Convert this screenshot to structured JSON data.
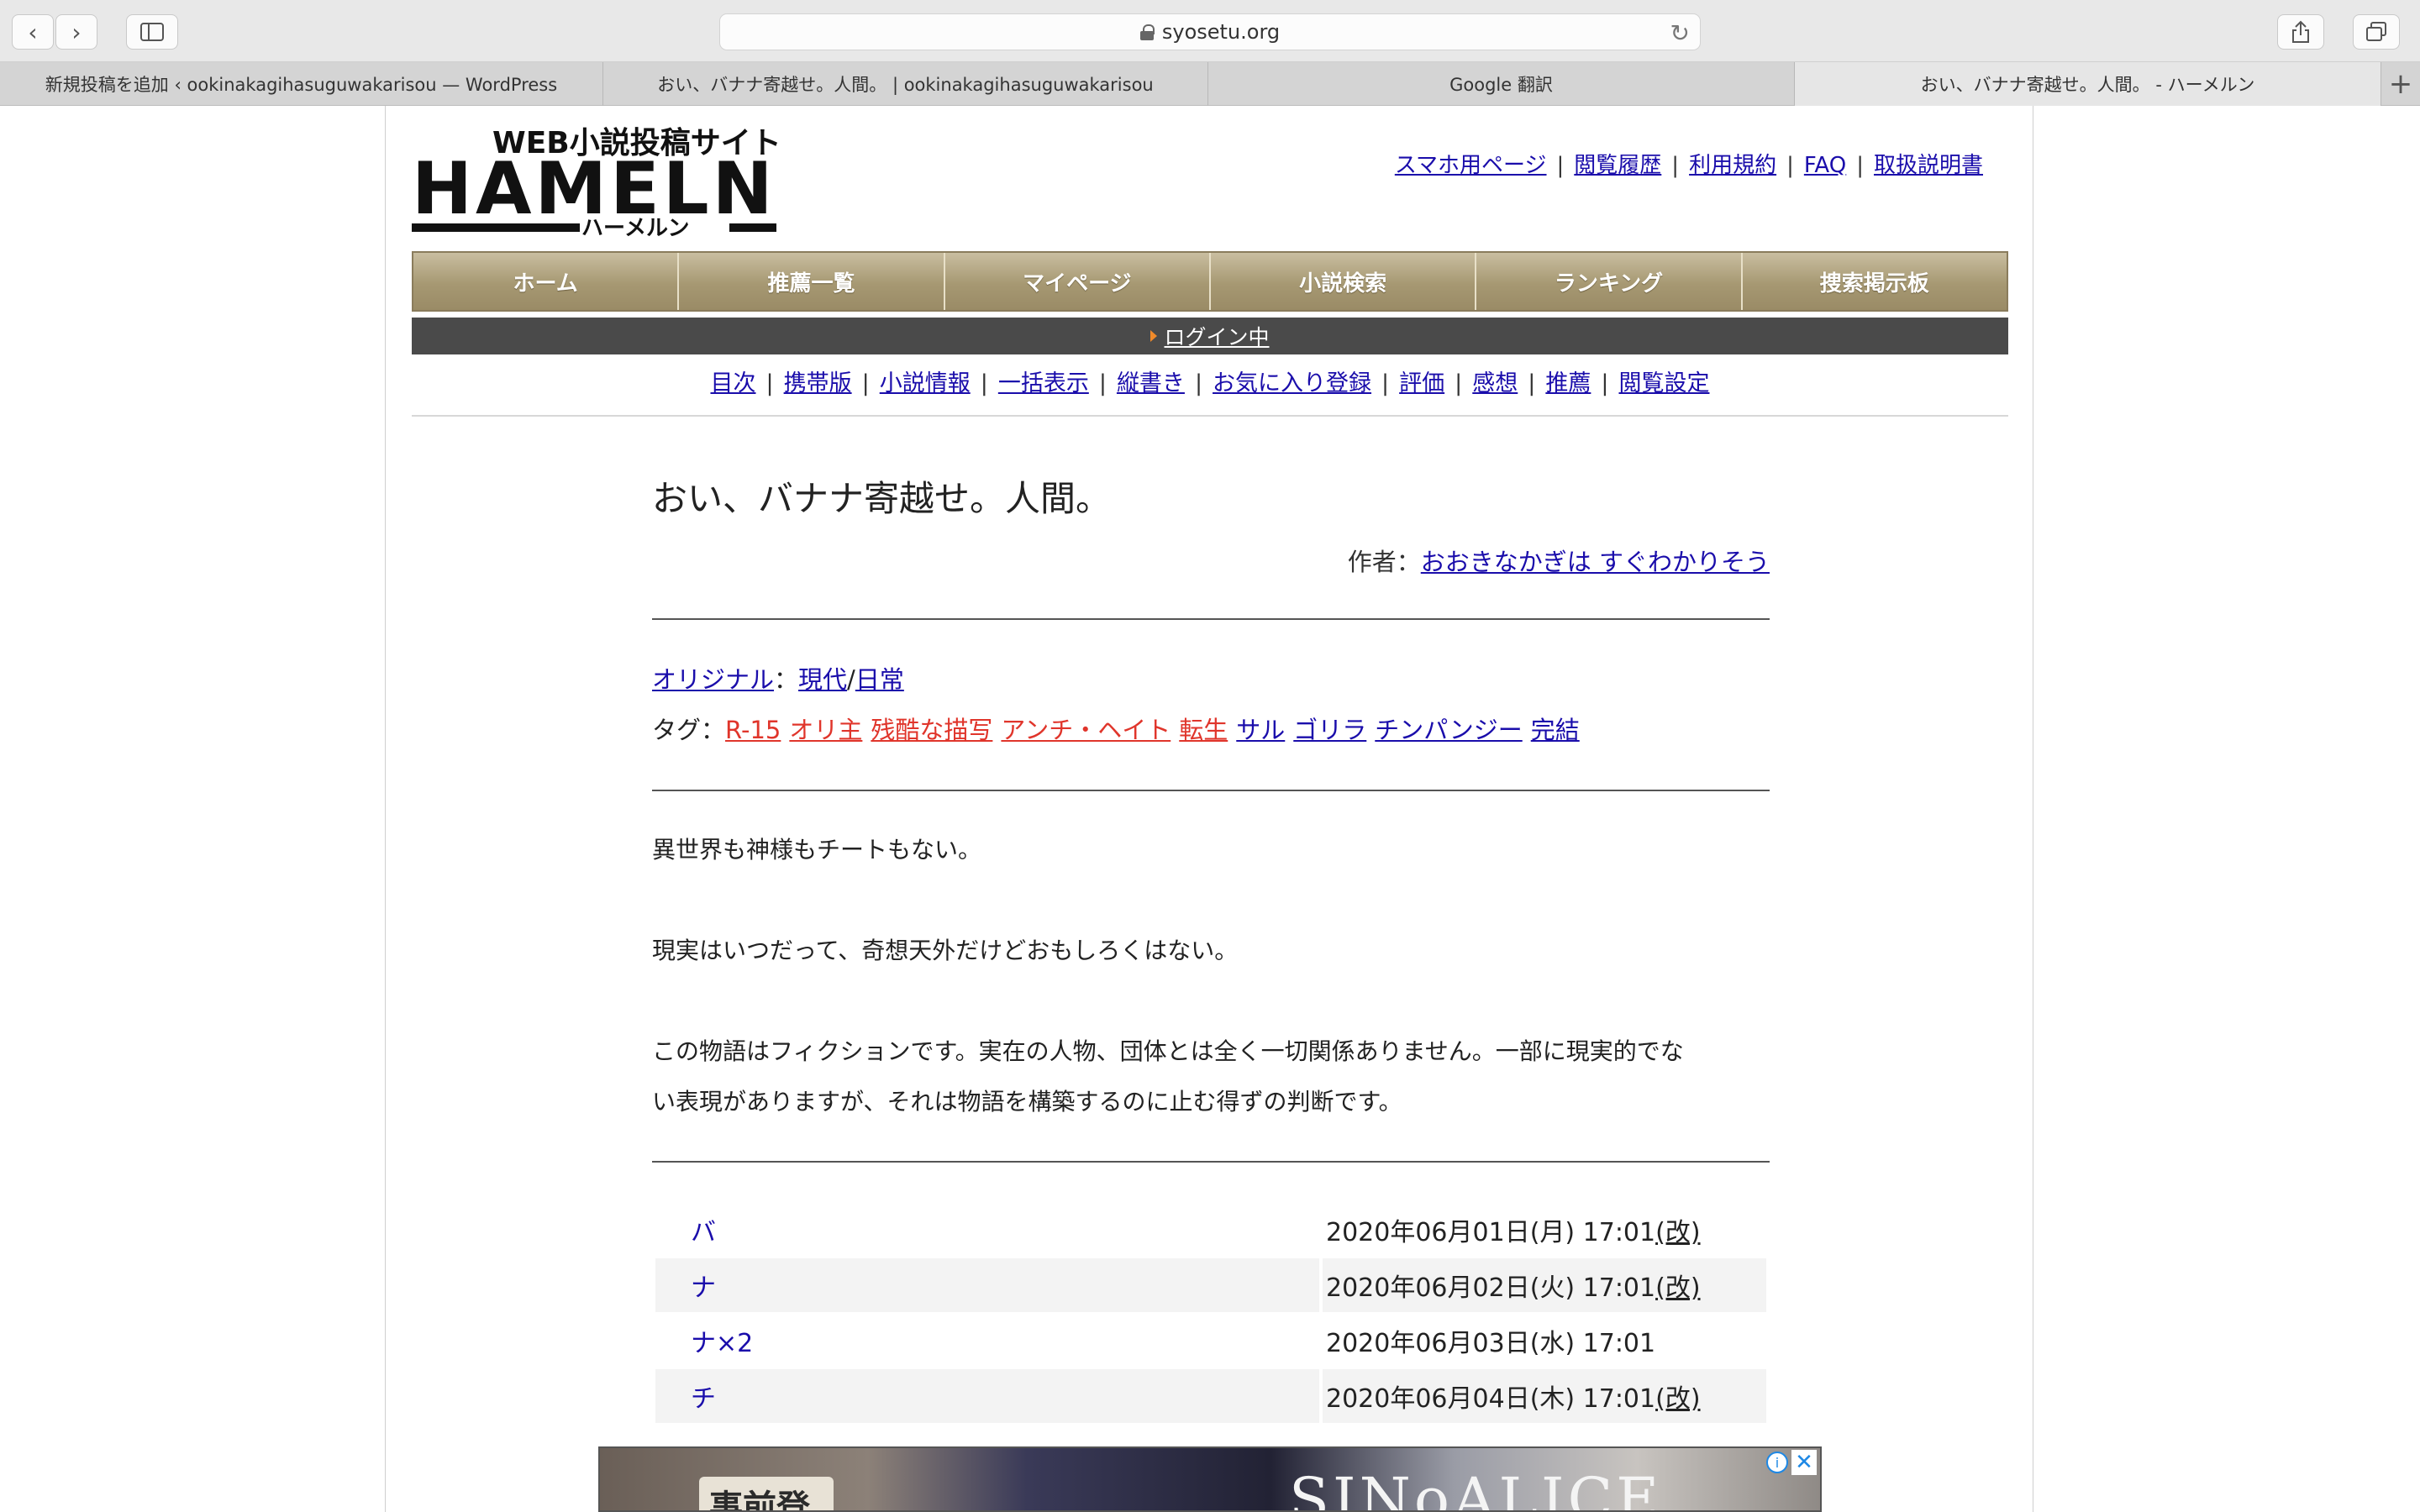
{
  "browser": {
    "url": "syosetu.org",
    "tabs": [
      {
        "title": "新規投稿を追加 ‹ ookinakagihasuguwakarisou — WordPress"
      },
      {
        "title": "おい、バナナ寄越せ。人間。 | ookinakagihasuguwakarisou"
      },
      {
        "title": "Google 翻訳"
      },
      {
        "title": "おい、バナナ寄越せ。人間。 - ハーメルン"
      }
    ]
  },
  "site": {
    "logo_text": "HAMELN",
    "logo_sub": "WEB小説投稿サイト",
    "logo_kana": "ハーメルン",
    "top_links": [
      "スマホ用ページ",
      "閲覧履歴",
      "利用規約",
      "FAQ",
      "取扱説明書"
    ],
    "main_nav": [
      "ホーム",
      "推薦一覧",
      "マイページ",
      "小説検索",
      "ランキング",
      "捜索掲示板"
    ],
    "login_status": "ログイン中",
    "sub_nav": [
      "目次",
      "携帯版",
      "小説情報",
      "一括表示",
      "縦書き",
      "お気に入り登録",
      "評価",
      "感想",
      "推薦",
      "閲覧設定"
    ]
  },
  "novel": {
    "title": "おい、バナナ寄越せ。人間。",
    "author_label": "作者：",
    "author": "おおきなかぎは すぐわかりそう",
    "original": "オリジナル",
    "genre_sep": "：",
    "genre1": "現代",
    "genre_slash": "/",
    "genre2": "日常",
    "tags_label": "タグ：",
    "tags_red": [
      "R-15",
      "オリ主",
      "残酷な描写",
      "アンチ・ヘイト",
      "転生"
    ],
    "tags_blue": [
      "サル",
      "ゴリラ",
      "チンパンジー",
      "完結"
    ],
    "summary": [
      "異世界も神様もチートもない。",
      "現実はいつだって、奇想天外だけどおもしろくはない。",
      "この物語はフィクションです。実在の人物、団体とは全く一切関係ありません。一部に現実的でな",
      "い表現がありますが、それは物語を構築するのに止む得ずの判断です。"
    ]
  },
  "chapters": [
    {
      "title": "バ",
      "date": "2020年06月01日(月) 17:01",
      "revised": "(改)"
    },
    {
      "title": "ナ",
      "date": "2020年06月02日(火) 17:01",
      "revised": "(改)"
    },
    {
      "title": "ナ×2",
      "date": "2020年06月03日(水) 17:01",
      "revised": ""
    },
    {
      "title": "チ",
      "date": "2020年06月04日(木) 17:01",
      "revised": "(改)"
    }
  ],
  "ad": {
    "preregister": "事前登録",
    "brand": "SINoALICE"
  }
}
